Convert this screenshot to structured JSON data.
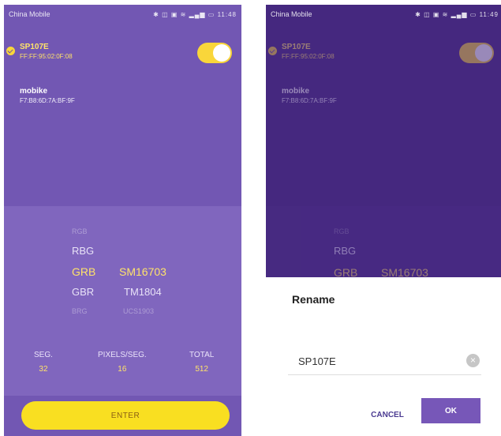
{
  "left_screen": {
    "status_bar": {
      "carrier": "China Mobile",
      "icons": "✱ ◫ ▣ ≋ ▂▄▆ ▭",
      "time": "11:48"
    },
    "devices": [
      {
        "name": "SP107E",
        "mac": "FF:FF:95:02:0F:08",
        "selected": true
      },
      {
        "name": "mobike",
        "mac": "F7:B8:6D:7A:BF:9F",
        "selected": false
      }
    ],
    "toggle_state": "on",
    "color_order_options": [
      "RGB",
      "RBG",
      "GRB",
      "GBR",
      "BRG"
    ],
    "selected_color_order": "GRB",
    "chip_options": [
      "SM16703",
      "TM1804",
      "UCS1903"
    ],
    "selected_chip": "SM16703",
    "stats": [
      {
        "label": "SEG.",
        "value": "32"
      },
      {
        "label": "PIXELS/SEG.",
        "value": "16"
      },
      {
        "label": "TOTAL",
        "value": "512"
      }
    ],
    "enter_label": "ENTER"
  },
  "right_screen": {
    "status_bar": {
      "carrier": "China Mobile",
      "icons": "✱ ◫ ▣ ≋ ▂▄▆ ▭",
      "time": "11:49"
    },
    "devices": [
      {
        "name": "SP107E",
        "mac": "FF:FF:95:02:0F:08"
      },
      {
        "name": "mobike",
        "mac": "F7:B8:6D:7A:BF:9F"
      }
    ],
    "color_order_options": [
      "RGB",
      "RBG",
      "GRB"
    ],
    "chip_selected": "SM16703",
    "dialog": {
      "title": "Rename",
      "input_value": "SP107E",
      "cancel_label": "CANCEL",
      "ok_label": "OK"
    }
  },
  "colors": {
    "left_background": "#7257b3",
    "right_background": "#45287f",
    "accent_yellow": "#f9df21",
    "selected_text": "#ffe36a",
    "dialog_button": "#7757b8"
  },
  "icons": [
    "check-icon",
    "toggle-switch",
    "clear-icon"
  ]
}
